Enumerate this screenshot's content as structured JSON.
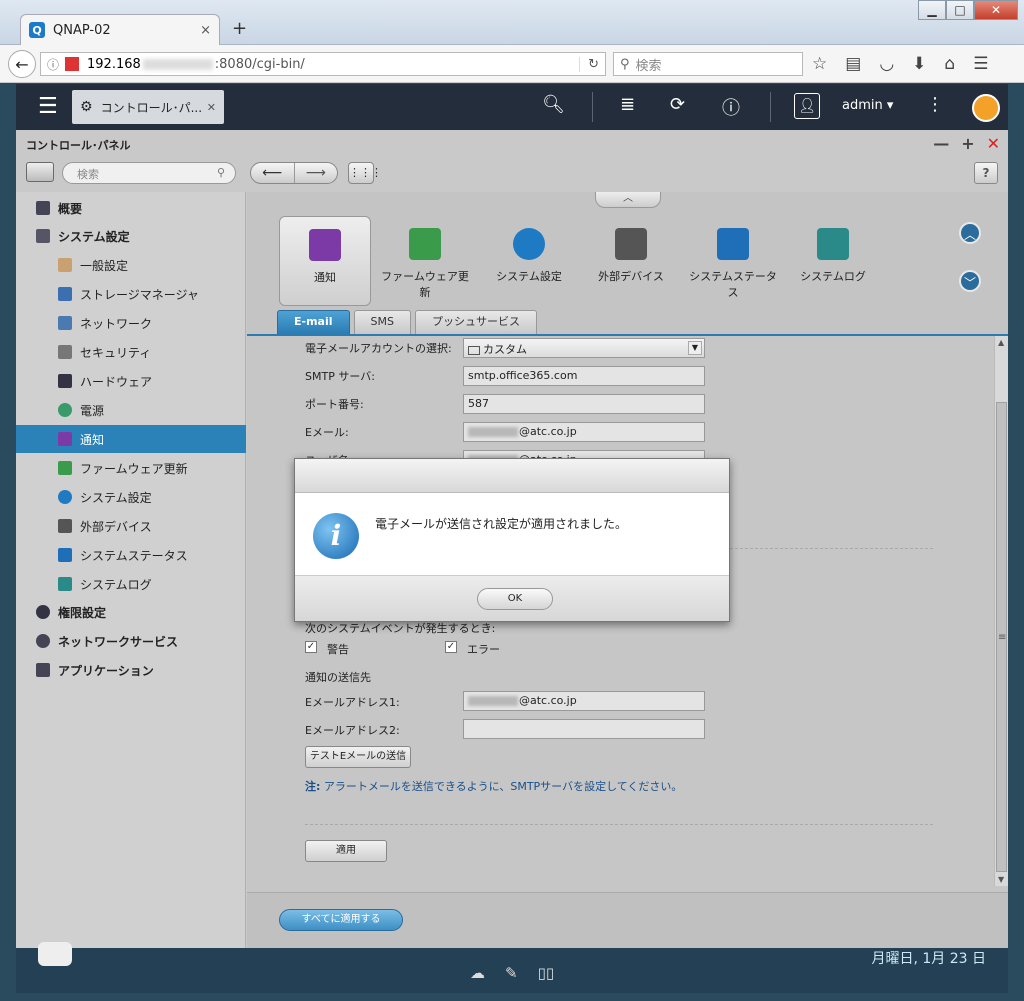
{
  "browser": {
    "tab_title": "QNAP-02",
    "tab_close": "×",
    "new_tab": "+",
    "url_host": "192.168",
    "url_rest": ":8080/cgi-bin/",
    "search_placeholder": "検索"
  },
  "qnap_top": {
    "app_tab_label": "コントロール･パ...",
    "user_label": "admin ▾"
  },
  "control_panel": {
    "title": "コントロール･パネル",
    "search_placeholder": "検索",
    "help_label": "?"
  },
  "sidebar": {
    "items": [
      {
        "label": "概要",
        "level": "top"
      },
      {
        "label": "システム設定",
        "level": "top"
      },
      {
        "label": "一般設定",
        "level": "sub"
      },
      {
        "label": "ストレージマネージャ",
        "level": "sub"
      },
      {
        "label": "ネットワーク",
        "level": "sub"
      },
      {
        "label": "セキュリティ",
        "level": "sub"
      },
      {
        "label": "ハードウェア",
        "level": "sub"
      },
      {
        "label": "電源",
        "level": "sub"
      },
      {
        "label": "通知",
        "level": "sub",
        "active": true
      },
      {
        "label": "ファームウェア更新",
        "level": "sub"
      },
      {
        "label": "システム設定",
        "level": "sub"
      },
      {
        "label": "外部デバイス",
        "level": "sub"
      },
      {
        "label": "システムステータス",
        "level": "sub"
      },
      {
        "label": "システムログ",
        "level": "sub"
      },
      {
        "label": "権限設定",
        "level": "top"
      },
      {
        "label": "ネットワークサービス",
        "level": "top"
      },
      {
        "label": "アプリケーション",
        "level": "top"
      }
    ]
  },
  "app_icons": [
    {
      "label": "通知",
      "selected": true,
      "color": "#7b3aa6"
    },
    {
      "label": "ファームウェア更新",
      "color": "#3a9b4a"
    },
    {
      "label": "システム設定",
      "color": "#1f7ac4"
    },
    {
      "label": "外部デバイス",
      "color": "#555555"
    },
    {
      "label": "システムステータス",
      "color": "#1f6fb8"
    },
    {
      "label": "システムログ",
      "color": "#2a8a8a"
    }
  ],
  "subtabs": [
    "E-mail",
    "SMS",
    "プッシュサービス"
  ],
  "form": {
    "account_label": "電子メールアカウントの選択:",
    "account_value": "カスタム",
    "smtp_label": "SMTP サーバ:",
    "smtp_value": "smtp.office365.com",
    "port_label": "ポート番号:",
    "port_value": "587",
    "email_label": "Eメール:",
    "email_value": "@atc.co.jp",
    "user_label": "ユーザ名:",
    "user_value": "@atc.co.jp",
    "events_label": "次のシステムイベントが発生するとき:",
    "warn_label": "警告",
    "error_label": "エラー",
    "dest_label": "通知の送信先",
    "addr1_label": "Eメールアドレス1:",
    "addr1_value": "@atc.co.jp",
    "addr2_label": "Eメールアドレス2:",
    "addr2_value": "",
    "test_button": "テストEメールの送信",
    "note_prefix": "注:",
    "note_text": " アラートメールを送信できるように、SMTPサーバを設定してください。",
    "apply_button": "適用"
  },
  "footer": {
    "apply_all": "すべてに適用する"
  },
  "dialog": {
    "message": "電子メールが送信され設定が適用されました。",
    "ok": "OK"
  },
  "desktop": {
    "clock": "月曜日, 1月 23 日"
  }
}
